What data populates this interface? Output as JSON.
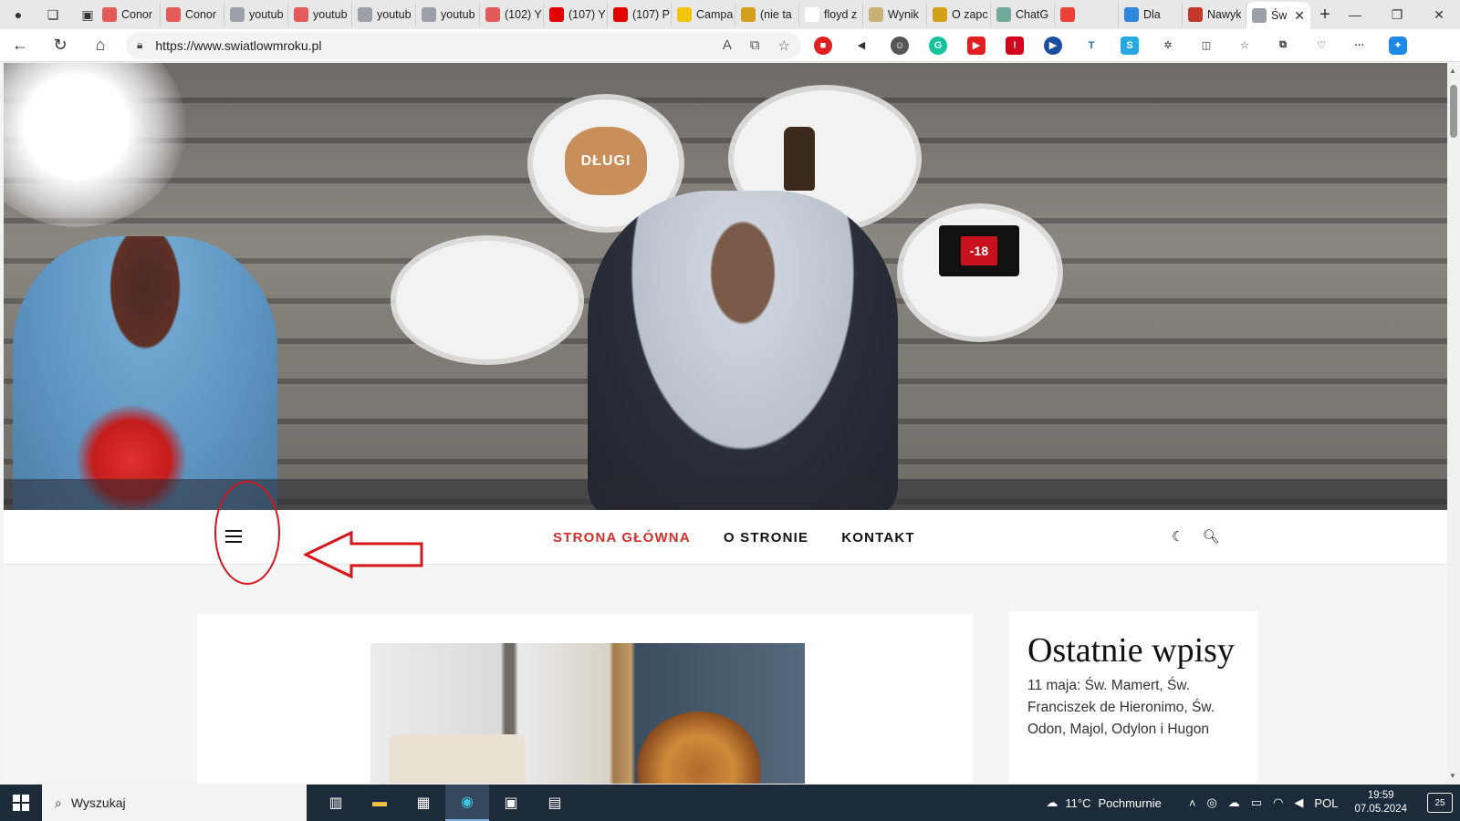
{
  "browser": {
    "tabs": [
      {
        "label": "Conor",
        "favicon": "youtube-studio-icon",
        "color": "#e25a5a"
      },
      {
        "label": "Conor",
        "favicon": "youtube-studio-icon",
        "color": "#e25a5a"
      },
      {
        "label": "youtub",
        "favicon": "document-icon",
        "color": "#9aa0a6"
      },
      {
        "label": "youtub",
        "favicon": "youtube-studio-icon",
        "color": "#e25a5a"
      },
      {
        "label": "youtub",
        "favicon": "document-icon",
        "color": "#9aa0a6"
      },
      {
        "label": "youtub",
        "favicon": "document-icon",
        "color": "#9aa0a6"
      },
      {
        "label": "(102) Y",
        "favicon": "youtube-studio-icon",
        "color": "#e25a5a"
      },
      {
        "label": "(107) Y",
        "favicon": "youtube-icon",
        "color": "#e00000"
      },
      {
        "label": "(107) P",
        "favicon": "youtube-icon",
        "color": "#e00000"
      },
      {
        "label": "Campa",
        "favicon": "coin-icon",
        "color": "#f1c40f"
      },
      {
        "label": "(nie ta",
        "favicon": "avatar-icon",
        "color": "#d4a017"
      },
      {
        "label": "floyd z",
        "favicon": "google-icon",
        "color": "#ffffff"
      },
      {
        "label": "Wynik",
        "favicon": "avatar-icon",
        "color": "#c8b27a"
      },
      {
        "label": "O zapc",
        "favicon": "avatar-icon",
        "color": "#d4a017"
      },
      {
        "label": "ChatG",
        "favicon": "chatgpt-icon",
        "color": "#74aa9c"
      },
      {
        "label": "",
        "favicon": "gmail-icon",
        "color": "#ea4335"
      },
      {
        "label": "Dla",
        "favicon": "diamond-icon",
        "color": "#2e86de"
      },
      {
        "label": "Nawyk",
        "favicon": "pdf-icon",
        "color": "#c0392b"
      },
      {
        "label": "Św",
        "favicon": "document-icon",
        "color": "#9aa0a6",
        "active": true
      }
    ],
    "new_tab": "+",
    "url": "https://www.swiatlowmroku.pl"
  },
  "site": {
    "menu": [
      {
        "label": "STRONA GŁÓWNA",
        "active": true
      },
      {
        "label": "O STRONIE"
      },
      {
        "label": "KONTAKT"
      }
    ],
    "hero": {
      "bag_text": "DŁUGI",
      "phone_text": "-18"
    },
    "sidebar": {
      "title": "Ostatnie wpisy",
      "first_post": "11 maja: Św. Mamert, Św. Franciszek de Hieronimo, Św. Odon, Majol, Odylon i Hugon"
    },
    "accent_color": "#d1302a"
  },
  "annotation": {
    "color": "#d8141c"
  },
  "taskbar": {
    "search_placeholder": "Wyszukaj",
    "weather_temp": "11°C",
    "weather_desc": "Pochmurnie",
    "language": "POL",
    "time": "19:59",
    "date": "07.05.2024",
    "notifications": "25"
  }
}
